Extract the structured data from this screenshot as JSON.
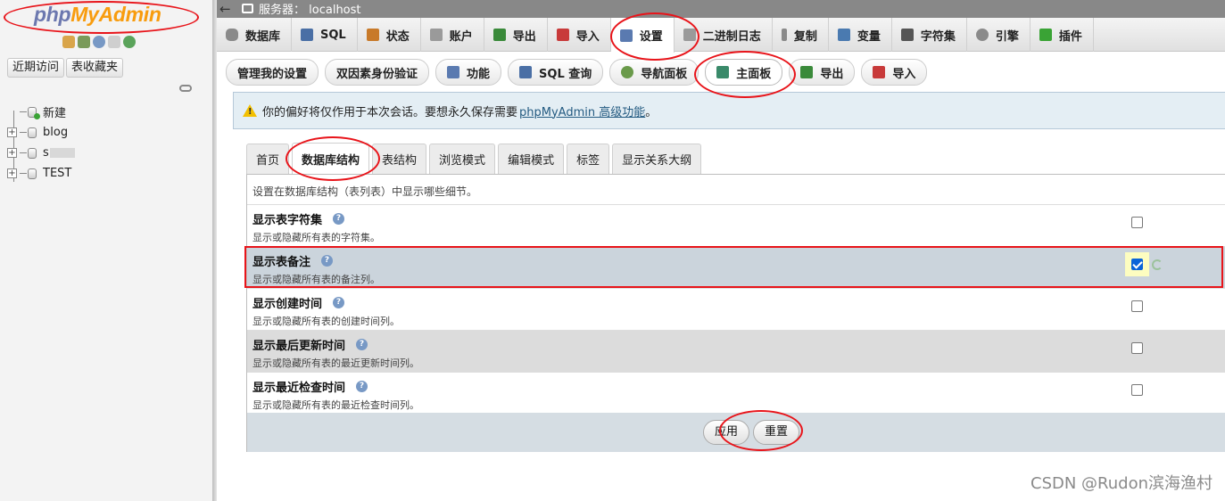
{
  "logo": {
    "part1": "php",
    "part2": "MyAdmin"
  },
  "nav": {
    "recent_label": "近期访问",
    "favorites_label": "表收藏夹",
    "tree": [
      {
        "label": "新建",
        "type": "new"
      },
      {
        "label": "blog",
        "type": "db"
      },
      {
        "label": "s",
        "type": "db"
      },
      {
        "label": "TEST",
        "type": "db"
      }
    ]
  },
  "serverbar": {
    "label": "服务器：",
    "host": "localhost"
  },
  "main_tabs": [
    {
      "label": "数据库",
      "icon": "database-icon",
      "color": "#8a8a8a"
    },
    {
      "label": "SQL",
      "icon": "sql-icon",
      "color": "#4a6fa5"
    },
    {
      "label": "状态",
      "icon": "status-icon",
      "color": "#c87a2a"
    },
    {
      "label": "账户",
      "icon": "users-icon",
      "color": "#7e7e7e"
    },
    {
      "label": "导出",
      "icon": "export-icon",
      "color": "#3a8a3a"
    },
    {
      "label": "导入",
      "icon": "import-icon",
      "color": "#c83a3a"
    },
    {
      "label": "设置",
      "icon": "wrench-icon",
      "color": "#5a7ab0",
      "active": true
    },
    {
      "label": "二进制日志",
      "icon": "binlog-icon",
      "color": "#9a9a9a"
    },
    {
      "label": "复制",
      "icon": "replication-icon",
      "color": "#8a8a8a"
    },
    {
      "label": "变量",
      "icon": "variables-icon",
      "color": "#4a7ab0"
    },
    {
      "label": "字符集",
      "icon": "charset-icon",
      "color": "#555555"
    },
    {
      "label": "引擎",
      "icon": "engine-icon",
      "color": "#8a8a8a"
    },
    {
      "label": "插件",
      "icon": "plugin-icon",
      "color": "#3aa335"
    }
  ],
  "sub_tabs": [
    {
      "label": "管理我的设置"
    },
    {
      "label": "双因素身份验证"
    },
    {
      "label": "功能",
      "icon": "wrench-icon"
    },
    {
      "label": "SQL 查询",
      "icon": "sql-icon"
    },
    {
      "label": "导航面板",
      "icon": "navigation-icon"
    },
    {
      "label": "主面板",
      "icon": "main-panel-icon",
      "active": true
    },
    {
      "label": "导出",
      "icon": "export-icon"
    },
    {
      "label": "导入",
      "icon": "import-icon"
    }
  ],
  "notice": {
    "text": "你的偏好将仅作用于本次会话。要想永久保存需要",
    "link": "phpMyAdmin 高级功能",
    "end": "。"
  },
  "form_tabs": [
    {
      "label": "首页"
    },
    {
      "label": "数据库结构",
      "active": true
    },
    {
      "label": "表结构"
    },
    {
      "label": "浏览模式"
    },
    {
      "label": "编辑模式"
    },
    {
      "label": "标签"
    },
    {
      "label": "显示关系大纲"
    }
  ],
  "panel": {
    "description": "设置在数据库结构（表列表）中显示哪些细节。",
    "rows": [
      {
        "title": "显示表字符集",
        "sub": "显示或隐藏所有表的字符集。",
        "checked": false
      },
      {
        "title": "显示表备注",
        "sub": "显示或隐藏所有表的备注列。",
        "checked": true
      },
      {
        "title": "显示创建时间",
        "sub": "显示或隐藏所有表的创建时间列。",
        "checked": false
      },
      {
        "title": "显示最后更新时间",
        "sub": "显示或隐藏所有表的最近更新时间列。",
        "checked": false
      },
      {
        "title": "显示最近检查时间",
        "sub": "显示或隐藏所有表的最近检查时间列。",
        "checked": false
      }
    ],
    "apply_label": "应用",
    "reset_label": "重置"
  },
  "watermark": "CSDN @Rudon滨海渔村",
  "colors": {
    "accent_red": "#e8141a",
    "link": "#235a81",
    "logo_blue": "#6c78af",
    "logo_orange": "#f89c0e"
  }
}
